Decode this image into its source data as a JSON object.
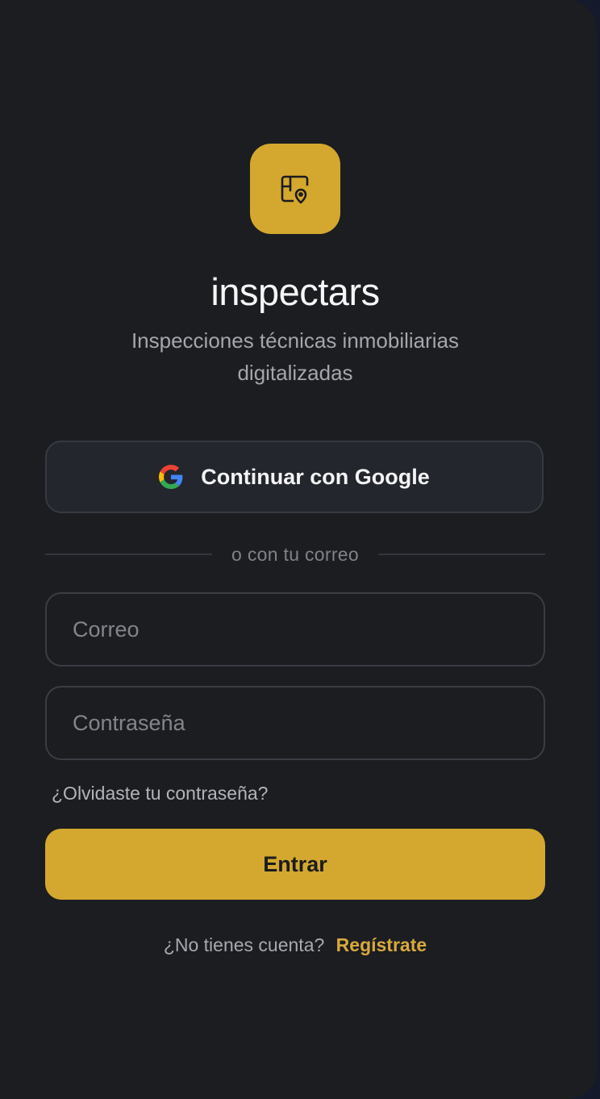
{
  "app": {
    "title": "inspectars",
    "subtitle": "Inspecciones técnicas inmobiliarias digitalizadas",
    "logo_icon": "floorplan-pin-icon",
    "accent_color": "#d4a82e"
  },
  "google_button": {
    "label": "Continuar con Google",
    "icon": "google-icon"
  },
  "divider": {
    "text": "o con tu correo"
  },
  "form": {
    "email_placeholder": "Correo",
    "email_value": "",
    "password_placeholder": "Contraseña",
    "password_value": "",
    "forgot_password": "¿Olvidaste tu contraseña?",
    "submit_label": "Entrar"
  },
  "signup": {
    "prompt": "¿No tienes cuenta?",
    "link": "Regístrate"
  }
}
